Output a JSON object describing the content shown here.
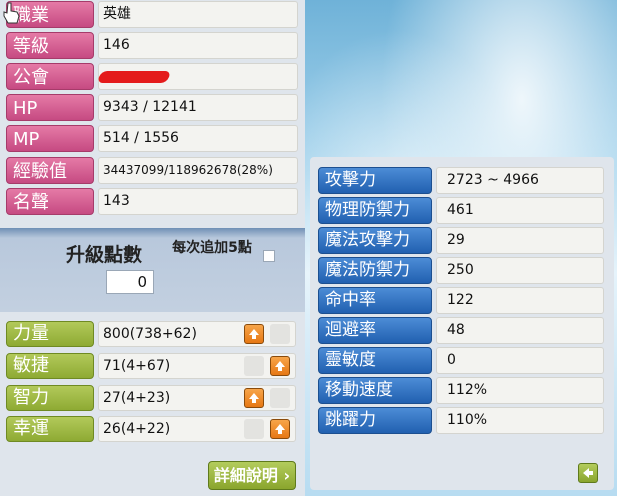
{
  "base_stats": [
    {
      "label": "職業",
      "value": "英雄"
    },
    {
      "label": "等級",
      "value": "146"
    },
    {
      "label": "公會",
      "value": ""
    },
    {
      "label": "HP",
      "value": "9343 / 12141"
    },
    {
      "label": "MP",
      "value": "514 / 1556"
    },
    {
      "label": "經驗值",
      "value": "34437099/118962678(28%)"
    },
    {
      "label": "名聲",
      "value": "143"
    }
  ],
  "level_points": {
    "label": "升級點數",
    "value": "0",
    "note": "每次追加5點"
  },
  "attributes": [
    {
      "label": "力量",
      "value": "800(738+62)"
    },
    {
      "label": "敏捷",
      "value": "71(4+67)"
    },
    {
      "label": "智力",
      "value": "27(4+23)"
    },
    {
      "label": "幸運",
      "value": "26(4+22)"
    }
  ],
  "detail_button": "詳細說明",
  "detail_stats": [
    {
      "label": "攻擊力",
      "value": "2723 ~ 4966"
    },
    {
      "label": "物理防禦力",
      "value": "461"
    },
    {
      "label": "魔法攻擊力",
      "value": "29"
    },
    {
      "label": "魔法防禦力",
      "value": "250"
    },
    {
      "label": "命中率",
      "value": "122"
    },
    {
      "label": "迴避率",
      "value": "48"
    },
    {
      "label": "靈敏度",
      "value": "0"
    },
    {
      "label": "移動速度",
      "value": "112%"
    },
    {
      "label": "跳躍力",
      "value": "110%"
    }
  ],
  "colors": {
    "label_pink": "#d45a8e",
    "label_green": "#9bb53f",
    "label_blue": "#2f70c2",
    "up_button": "#ee8a25"
  }
}
